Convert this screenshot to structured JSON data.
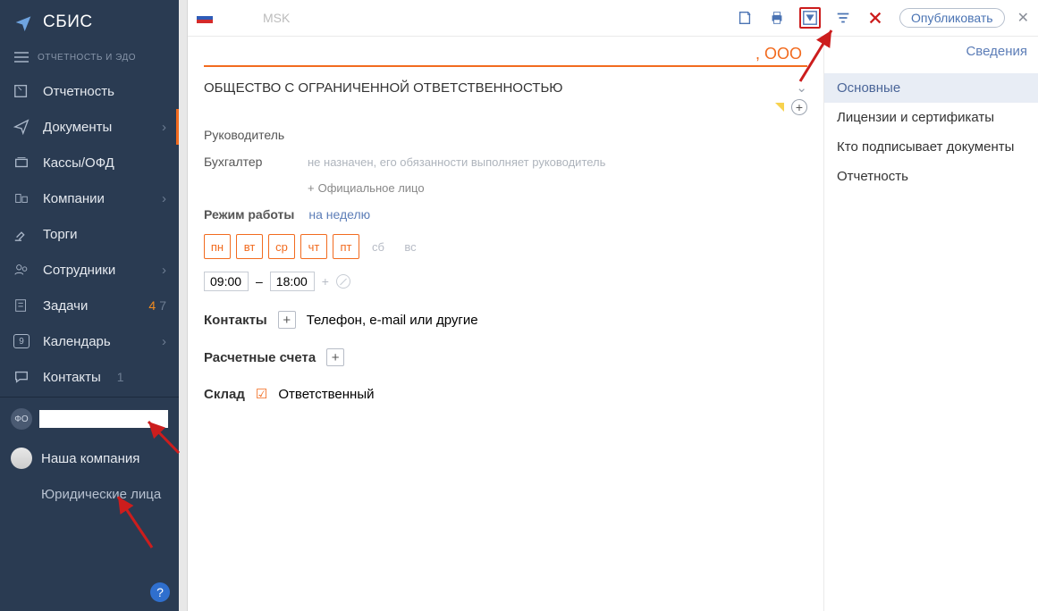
{
  "app": {
    "title": "СБИС",
    "subtitle": "ОТЧЕТНОСТЬ И ЭДО"
  },
  "sidebar": {
    "items": [
      {
        "label": "Отчетность"
      },
      {
        "label": "Документы"
      },
      {
        "label": "Кассы/ОФД"
      },
      {
        "label": "Компании"
      },
      {
        "label": "Торги"
      },
      {
        "label": "Сотрудники"
      },
      {
        "label": "Задачи",
        "c1": "4",
        "c2": "7"
      },
      {
        "label": "Календарь",
        "c1": "9"
      },
      {
        "label": "Контакты",
        "c1": "1"
      }
    ],
    "avatar_text": "ФО",
    "our_company": "Наша компания",
    "legal": "Юридические лица",
    "help": "?"
  },
  "topbar": {
    "msk": "MSK",
    "publish": "Опубликовать"
  },
  "main": {
    "title_suffix": ", ООО",
    "legal_full": "ОБЩЕСТВО С ОГРАНИЧЕННОЙ ОТВЕТСТВЕННОСТЬЮ",
    "manager_label": "Руководитель",
    "accountant_label": "Бухгалтер",
    "accountant_hint": "не назначен, его обязанности выполняет руководитель",
    "add_official": "Официальное лицо",
    "schedule_label": "Режим работы",
    "schedule_link": "на неделю",
    "days": [
      "пн",
      "вт",
      "ср",
      "чт",
      "пт",
      "сб",
      "вс"
    ],
    "time_from": "09:00",
    "time_to": "18:00",
    "contacts_label": "Контакты",
    "contacts_hint": "Телефон, e-mail или другие",
    "accounts_label": "Расчетные счета",
    "warehouse_label": "Склад",
    "warehouse_hint": "Ответственный"
  },
  "side": {
    "tab": "Сведения",
    "items": [
      "Основные",
      "Лицензии и сертификаты",
      "Кто подписывает документы",
      "Отчетность"
    ]
  }
}
